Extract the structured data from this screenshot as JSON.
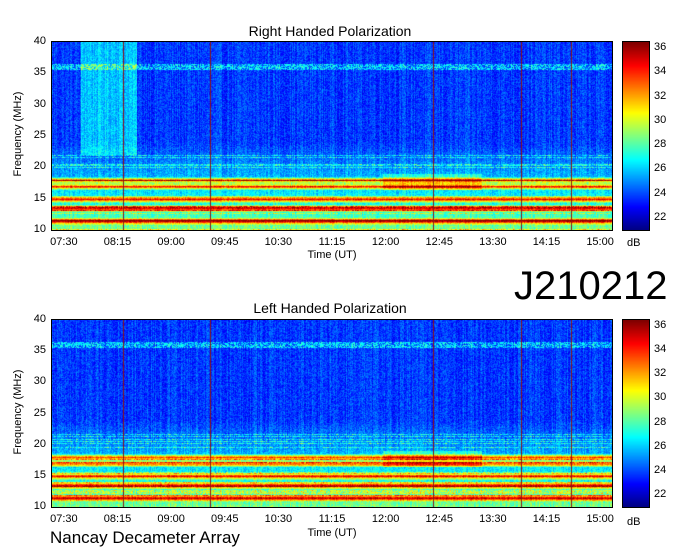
{
  "chart_data": [
    {
      "type": "heatmap",
      "title": "Right Handed Polarization",
      "xlabel": "Time (UT)",
      "ylabel": "Frequency (MHz)",
      "x_ticks": [
        "07:30",
        "08:15",
        "09:00",
        "09:45",
        "10:30",
        "11:15",
        "12:00",
        "12:45",
        "13:30",
        "14:15",
        "15:00"
      ],
      "y_ticks": [
        "40",
        "35",
        "30",
        "25",
        "20",
        "15",
        "10"
      ],
      "xlim": [
        "07:20",
        "15:10"
      ],
      "ylim": [
        10,
        40
      ],
      "colorbar": {
        "label": "dB",
        "ticks": [
          "36",
          "34",
          "32",
          "30",
          "28",
          "26",
          "24",
          "22"
        ],
        "range": [
          21,
          36.5
        ]
      },
      "vertical_lines_ut": [
        "08:20",
        "09:33",
        "12:40",
        "13:54",
        "14:36"
      ],
      "strong_bands_mhz": [
        11.5,
        13.5,
        15,
        17,
        18
      ]
    },
    {
      "type": "heatmap",
      "title": "Left Handed Polarization",
      "xlabel": "Time (UT)",
      "ylabel": "Frequency (MHz)",
      "x_ticks": [
        "07:30",
        "08:15",
        "09:00",
        "09:45",
        "10:30",
        "11:15",
        "12:00",
        "12:45",
        "13:30",
        "14:15",
        "15:00"
      ],
      "y_ticks": [
        "40",
        "35",
        "30",
        "25",
        "20",
        "15",
        "10"
      ],
      "xlim": [
        "07:20",
        "15:10"
      ],
      "ylim": [
        10,
        40
      ],
      "colorbar": {
        "label": "dB",
        "ticks": [
          "36",
          "34",
          "32",
          "30",
          "28",
          "26",
          "24",
          "22"
        ],
        "range": [
          21,
          36.5
        ]
      },
      "vertical_lines_ut": [
        "08:20",
        "09:33",
        "12:40",
        "13:54",
        "14:36"
      ],
      "strong_bands_mhz": [
        11.5,
        13.5,
        15,
        17,
        18
      ]
    }
  ],
  "date_id": "J210212",
  "footer": "Nancay Decameter Array"
}
